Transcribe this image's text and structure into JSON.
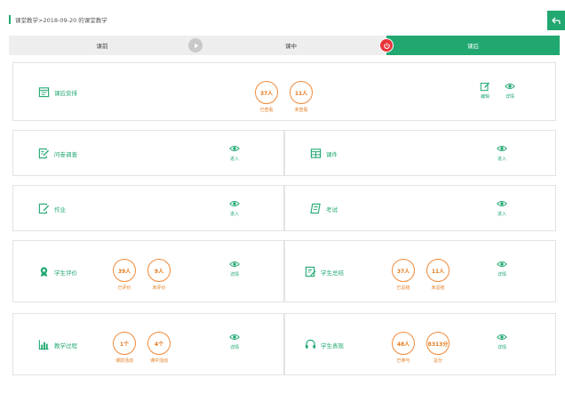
{
  "header": {
    "title": "课堂教学>2018-09-20 的课堂教学"
  },
  "steps": [
    {
      "label": "课前"
    },
    {
      "label": "课中"
    },
    {
      "label": "课后"
    }
  ],
  "sections": {
    "homework_plan": {
      "label": "课后安排",
      "stats": [
        {
          "value": "37人",
          "caption": "已查看"
        },
        {
          "value": "11人",
          "caption": "未查看"
        }
      ],
      "edit_label": "编辑",
      "detail_label": "详情"
    },
    "survey": {
      "label": "问卷调查",
      "action": "进入"
    },
    "courseware": {
      "label": "课件",
      "action": "进入"
    },
    "assignment": {
      "label": "作业",
      "action": "进入"
    },
    "exam": {
      "label": "考试",
      "action": "进入"
    },
    "student_eval": {
      "label": "学生评价",
      "stats": [
        {
          "value": "39人",
          "caption": "已评价"
        },
        {
          "value": "9人",
          "caption": "未评价"
        }
      ],
      "action": "详情"
    },
    "student_summary": {
      "label": "学生总结",
      "stats": [
        {
          "value": "37人",
          "caption": "已总结"
        },
        {
          "value": "11人",
          "caption": "未总结"
        }
      ],
      "action": "详情"
    },
    "teaching_process": {
      "label": "教学过程",
      "stats": [
        {
          "value": "1个",
          "caption": "课前活动"
        },
        {
          "value": "4个",
          "caption": "课中活动"
        }
      ],
      "action": "详情"
    },
    "student_performance": {
      "label": "学生表现",
      "stats": [
        {
          "value": "48人",
          "caption": "已参与"
        },
        {
          "value": "8313分",
          "caption": "总分"
        }
      ],
      "action": "详情"
    }
  },
  "colors": {
    "accent": "#21a871",
    "stat": "#f08a3a",
    "power": "#e8363b",
    "step_bg": "#eeeeee"
  }
}
